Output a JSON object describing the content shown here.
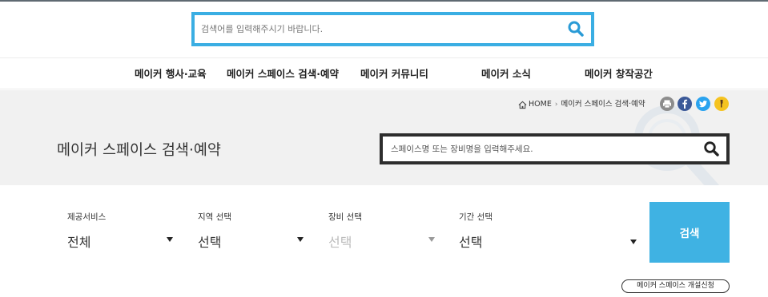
{
  "header": {
    "search_placeholder": "검색어를 입력해주시기 바랍니다."
  },
  "nav": {
    "items": [
      {
        "label": "메이커 행사·교육"
      },
      {
        "label": "메이커 스페이스 검색·예약"
      },
      {
        "label": "메이커 커뮤니티"
      },
      {
        "label": "메이커 소식"
      },
      {
        "label": "메이커 창작공간"
      }
    ]
  },
  "breadcrumb": {
    "home": "HOME",
    "current": "메이커 스페이스 검색·예약"
  },
  "social": {
    "icons": [
      "print-icon",
      "facebook-icon",
      "twitter-icon",
      "kakaostory-icon"
    ],
    "colors": {
      "print": "#8c8c8c",
      "facebook": "#3b5998",
      "twitter": "#2aa3ef",
      "kakaostory": "#f5c320"
    }
  },
  "page": {
    "title": "메이커 스페이스 검색·예약"
  },
  "space_search": {
    "placeholder": "스페이스명 또는 장비명을 입력해주세요."
  },
  "filters": [
    {
      "label": "제공서비스",
      "value": "전체",
      "disabled": false
    },
    {
      "label": "지역 선택",
      "value": "선택",
      "disabled": false
    },
    {
      "label": "장비 선택",
      "value": "선택",
      "disabled": true
    },
    {
      "label": "기간 선택",
      "value": "선택",
      "disabled": false
    }
  ],
  "search_button": {
    "label": "검색"
  },
  "open_button": {
    "label": "메이커 스페이스 개설신청"
  },
  "colors": {
    "accent": "#3aaee3",
    "search_button": "#3fb2e3",
    "hero_background": "#f1f1f1"
  }
}
